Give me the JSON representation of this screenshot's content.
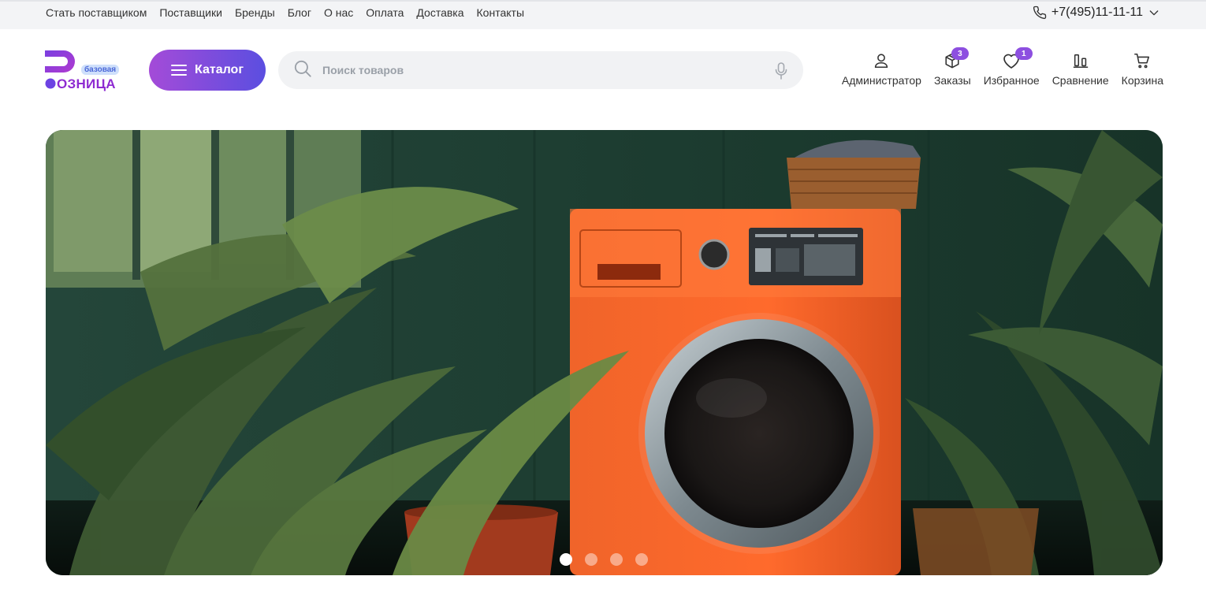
{
  "topbar": {
    "links": [
      "Стать поставщиком",
      "Поставщики",
      "Бренды",
      "Блог",
      "О нас",
      "Оплата",
      "Доставка",
      "Контакты"
    ],
    "phone": "+7(495)11-11-11"
  },
  "logo": {
    "word": "ОЗНИЦА",
    "badge": "базовая"
  },
  "catalog": {
    "label": "Каталог"
  },
  "search": {
    "placeholder": "Поиск товаров",
    "value": ""
  },
  "actions": {
    "account": {
      "label": "Администратор",
      "icon": "user-icon"
    },
    "orders": {
      "label": "Заказы",
      "icon": "box-icon",
      "count": "3"
    },
    "favorites": {
      "label": "Избранное",
      "icon": "heart-icon",
      "count": "1"
    },
    "compare": {
      "label": "Сравнение",
      "icon": "compare-icon"
    },
    "cart": {
      "label": "Корзина",
      "icon": "cart-icon"
    }
  },
  "hero": {
    "image": "orange washing machine among green plants",
    "slides_total": 4,
    "active_slide": 1
  },
  "colors": {
    "accent_start": "#a44bd8",
    "accent_end": "#5b4ee0",
    "badge": "#8d4fe0",
    "logo": "#8e2bd1"
  }
}
